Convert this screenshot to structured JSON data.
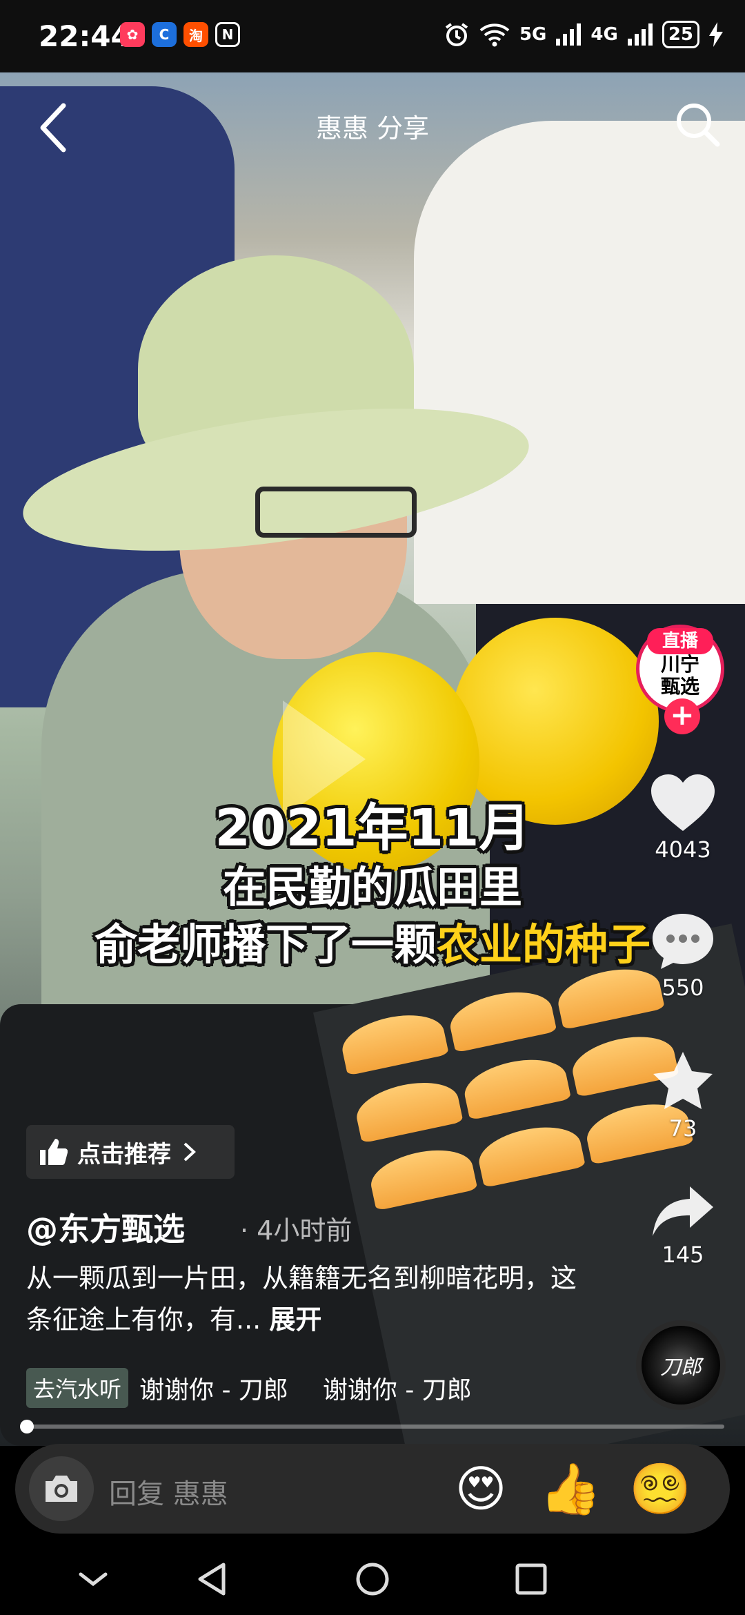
{
  "status_bar": {
    "time": "22:44",
    "apps": [
      {
        "icon": "app-red-icon",
        "label": "✿",
        "color": "#ff3b5c"
      },
      {
        "icon": "app-blue-icon",
        "label": "C",
        "color": "#ffffff"
      },
      {
        "icon": "taobao-icon",
        "label": "淘",
        "color": "#ff4f00"
      },
      {
        "icon": "nfc-icon",
        "label": "N",
        "color": "#ffffff"
      }
    ],
    "signal_5g": "5G",
    "signal_4g": "4G",
    "battery": "25"
  },
  "header": {
    "title": "惠惠 分享"
  },
  "video": {
    "captions": {
      "line1": "2021年11月",
      "line2": "在民勤的瓜田里",
      "line3_plain": "俞老师播下了一颗",
      "line3_highlight": "农业的种子"
    }
  },
  "side_actions": {
    "avatar_text": "川宁\n甄选",
    "live_badge": "直播",
    "follow_label": "+",
    "likes": "4043",
    "comments": "550",
    "favorites": "73",
    "shares": "145",
    "disc_text": "刀郎"
  },
  "post": {
    "recommend_label": "点击推荐",
    "author": "@东方甄选",
    "time_ago": "· 4小时前",
    "description": "从一颗瓜到一片田，从籍籍无名到柳暗花明，这条征途上有你，有...",
    "expand_label": "展开",
    "music_tag": "去汽水听",
    "music_track_1": "谢谢你 - 刀郎",
    "music_track_2": "谢谢你 - 刀郎"
  },
  "progress": {
    "fraction": 0.005
  },
  "reply": {
    "placeholder": "回复 惠惠",
    "emojis": [
      "😍",
      "👍",
      "😵‍💫"
    ]
  },
  "colors": {
    "accent": "#ff2c58",
    "highlight_caption": "#ffd11a"
  }
}
